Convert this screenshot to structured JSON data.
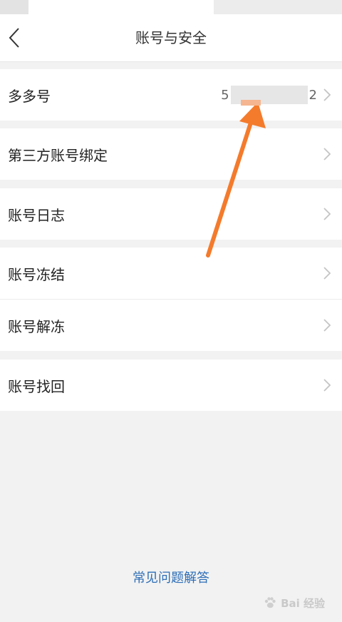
{
  "header": {
    "title": "账号与安全",
    "back_icon": "chevron-left-icon"
  },
  "rows": {
    "duoduo_id": {
      "label": "多多号",
      "value_start": "5",
      "value_end": "2"
    },
    "third_party": {
      "label": "第三方账号绑定"
    },
    "log": {
      "label": "账号日志"
    },
    "freeze": {
      "label": "账号冻结"
    },
    "unfreeze": {
      "label": "账号解冻"
    },
    "recover": {
      "label": "账号找回"
    }
  },
  "footer": {
    "faq_label": "常见问题解答"
  },
  "watermark": {
    "text": "Bai 经验"
  },
  "colors": {
    "link": "#2d6eb7",
    "annotation_arrow": "#f47b2c",
    "background": "#f2f2f2"
  }
}
